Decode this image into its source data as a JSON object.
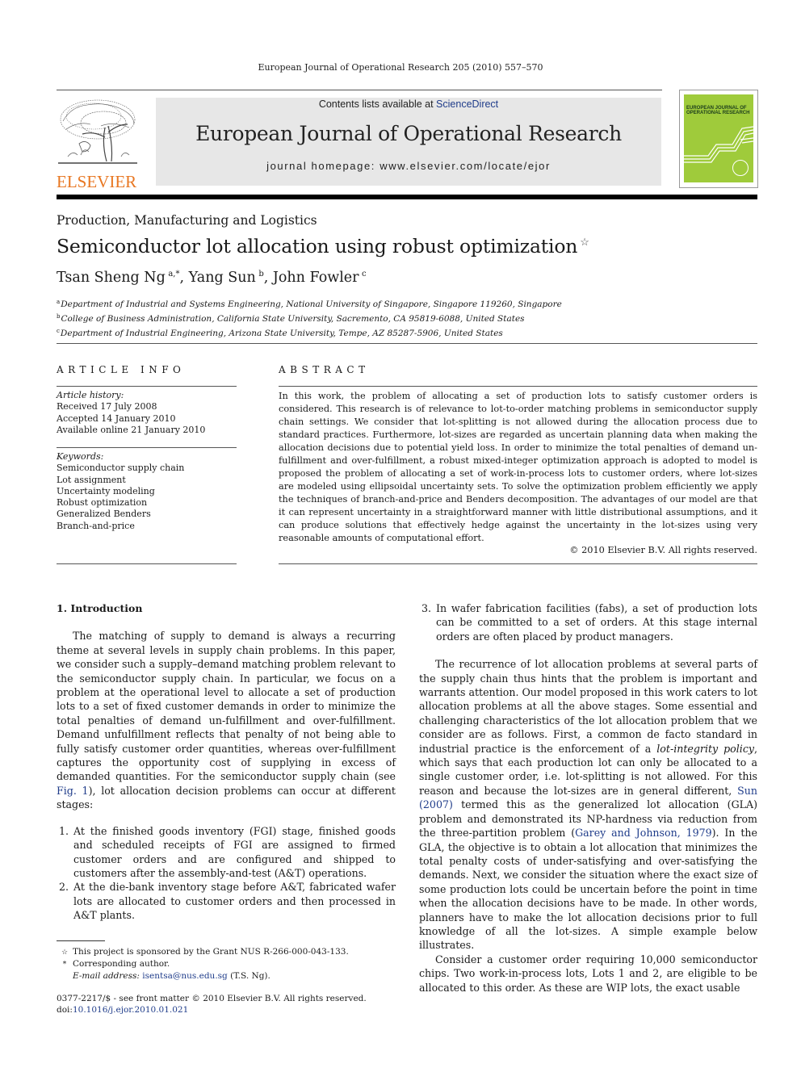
{
  "running_head": "European Journal of Operational Research 205 (2010) 557–570",
  "header": {
    "publisher_wordmark": "ELSEVIER",
    "contents_prefix": "Contents lists available at ",
    "contents_link": "ScienceDirect",
    "journal_title": "European Journal of Operational Research",
    "homepage_label": "journal homepage: ",
    "homepage_url": "www.elsevier.com/locate/ejor",
    "cover_title_line1": "EUROPEAN JOURNAL OF",
    "cover_title_line2": "OPERATIONAL RESEARCH",
    "colors": {
      "publisher_orange": "#e87722",
      "masthead_gray": "#e7e7e7",
      "cover_green": "#9fcb3b",
      "link_blue": "#1f3c8a"
    }
  },
  "article": {
    "section": "Production, Manufacturing and Logistics",
    "title": "Semiconductor lot allocation using robust optimization",
    "title_mark": "☆",
    "authors": [
      {
        "name": "Tsan Sheng Ng",
        "sup": "a,*",
        "sep": ", "
      },
      {
        "name": "Yang Sun",
        "sup": "b",
        "sep": ", "
      },
      {
        "name": "John Fowler",
        "sup": "c",
        "sep": ""
      }
    ],
    "affiliations": [
      {
        "sup": "a",
        "text": "Department of Industrial and Systems Engineering, National University of Singapore, Singapore 119260, Singapore"
      },
      {
        "sup": "b",
        "text": "College of Business Administration, California State University, Sacremento, CA 95819-6088, United States"
      },
      {
        "sup": "c",
        "text": "Department of Industrial Engineering, Arizona State University, Tempe, AZ 85287-5906, United States"
      }
    ]
  },
  "article_info": {
    "heading": "ARTICLE INFO",
    "history_label": "Article history:",
    "history": [
      "Received 17 July 2008",
      "Accepted 14 January 2010",
      "Available online 21 January 2010"
    ],
    "keywords_label": "Keywords:",
    "keywords": [
      "Semiconductor supply chain",
      "Lot assignment",
      "Uncertainty modeling",
      "Robust optimization",
      "Generalized Benders",
      "Branch-and-price"
    ]
  },
  "abstract": {
    "heading": "ABSTRACT",
    "text": "In this work, the problem of allocating a set of production lots to satisfy customer orders is considered. This research is of relevance to lot-to-order matching problems in semiconductor supply chain settings. We consider that lot-splitting is not allowed during the allocation process due to standard practices. Furthermore, lot-sizes are regarded as uncertain planning data when making the allocation decisions due to potential yield loss. In order to minimize the total penalties of demand un-fulfillment and over-fulfillment, a robust mixed-integer optimization approach is adopted to model is proposed the problem of allocating a set of work-in-process lots to customer orders, where lot-sizes are modeled using ellipsoidal uncertainty sets. To solve the optimization problem efficiently we apply the techniques of branch-and-price and Benders decomposition. The advantages of our model are that it can represent uncertainty in a straightforward manner with little distributional assumptions, and it can produce solutions that effectively hedge against the uncertainty in the lot-sizes using very reasonable amounts of computational effort.",
    "copyright": "© 2010 Elsevier B.V. All rights reserved."
  },
  "body": {
    "section_heading": "1. Introduction",
    "intro_p1_before": "The matching of supply to demand is always a recurring theme at several levels in supply chain problems. In this paper, we consider such a supply–demand matching problem relevant to the semiconductor supply chain. In particular, we focus on a problem at the operational level to allocate a set of production lots to a set of fixed customer demands in order to minimize the total penalties of demand un-fulfillment and over-fulfillment. Demand unfulfillment reflects that penalty of not being able to fully satisfy customer order quantities, whereas over-fulfillment captures the opportunity cost of supplying in excess of demanded quantities. For the semiconductor supply chain (see ",
    "intro_p1_link": "Fig. 1",
    "intro_p1_after": "), lot allocation decision problems can occur at different stages:",
    "list": [
      {
        "num": "1.",
        "text": "At the finished goods inventory (FGI) stage, finished goods and scheduled receipts of FGI are assigned to firmed customer orders and are configured and shipped to customers after the assembly-and-test (A&T) operations."
      },
      {
        "num": "2.",
        "text": "At the die-bank inventory stage before A&T, fabricated wafer lots are allocated to customer orders and then processed in A&T plants."
      },
      {
        "num": "3.",
        "text": "In wafer fabrication facilities (fabs), a set of production lots can be committed to a set of orders. At this stage internal orders are often placed by product managers."
      }
    ],
    "p2_a": "The recurrence of lot allocation problems at several parts of the supply chain thus hints that the problem is important and warrants attention. Our model proposed in this work caters to lot allocation problems at all the above stages. Some essential and challenging characteristics of the lot allocation problem that we consider are as follows. First, a common de facto standard in industrial practice is the enforcement of a ",
    "p2_italic": "lot-integrity policy",
    "p2_b": ", which says that each production lot can only be allocated to a single customer order, i.e. lot-splitting is not allowed. For this reason and because the lot-sizes are in general different, ",
    "p2_link1": "Sun (2007)",
    "p2_c": " termed this as the generalized lot allocation (GLA) problem and demonstrated its NP-hardness via reduction from the three-partition problem (",
    "p2_link2": "Garey and Johnson, 1979",
    "p2_d": "). In the GLA, the objective is to obtain a lot allocation that minimizes the total penalty costs of under-satisfying and over-satisfying the demands. Next, we consider the situation where the exact size of some production lots could be uncertain before the point in time when the allocation decisions have to be made. In other words, planners have to make the lot allocation decisions prior to full knowledge of all the lot-sizes. A simple example below illustrates.",
    "p3": "Consider a customer order requiring 10,000 semiconductor chips. Two work-in-process lots, Lots 1 and 2, are eligible to be allocated to this order. As these are WIP lots, the exact usable"
  },
  "footnotes": {
    "star_mark": "☆",
    "star_text": "This project is sponsored by the Grant NUS R-266-000-043-133.",
    "corr_mark": "*",
    "corr_text": "Corresponding author.",
    "email_label": "E-mail address:",
    "email": "isentsa@nus.edu.sg",
    "email_suffix": " (T.S. Ng).",
    "issn_line": "0377-2217/$ - see front matter © 2010 Elsevier B.V. All rights reserved.",
    "doi_label": "doi:",
    "doi": "10.1016/j.ejor.2010.01.021"
  }
}
